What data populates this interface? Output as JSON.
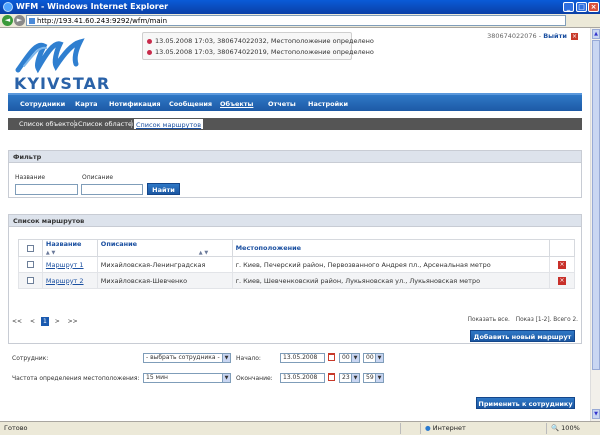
{
  "window": {
    "title": "WFM - Windows Internet Explorer"
  },
  "address": {
    "url": "http://193.41.60.243:9292/wfm/main"
  },
  "brand": {
    "logo_text": "KYIVSTAR"
  },
  "notifications": [
    "13.05.2008 17:03, 380674022032, Местоположение определено",
    "13.05.2008 17:03, 380674022019, Местоположение определено"
  ],
  "user": {
    "phone": "380674022076",
    "logout": "Выйти"
  },
  "nav": {
    "items": [
      "Сотрудники",
      "Карта",
      "Нотификация",
      "Сообщения",
      "Объекты",
      "Отчеты",
      "Настройки"
    ],
    "active": "Объекты"
  },
  "subnav": {
    "items": [
      "Список объектов",
      "Список областей",
      "Список маршрутов"
    ],
    "active": "Список маршрутов"
  },
  "filter": {
    "title": "Фильтр",
    "name_label": "Название",
    "desc_label": "Описание",
    "name_value": "",
    "desc_value": "",
    "find": "Найти"
  },
  "routes": {
    "title": "Список маршрутов",
    "columns": [
      "Название",
      "Описание",
      "Местоположение"
    ],
    "rows": [
      {
        "name": "Маршрут 1",
        "desc": "Михайловская-Ленинградская",
        "loc": "г. Киев, Печерский район, Первозванного Андрея пл., Арсенальная метро"
      },
      {
        "name": "Маршрут 2",
        "desc": "Михайловская-Шевченко",
        "loc": "г. Киев, Шевченковский район, Лукьяновская ул., Лукьяновская метро"
      }
    ],
    "pager": {
      "first": "<<",
      "prev": "<",
      "current": "1",
      "next": ">",
      "last": ">>",
      "show_all": "Показать все.",
      "range": "Показ [1-2]. Всего 2."
    },
    "add_button": "Добавить новый маршрут"
  },
  "assign": {
    "employee_label": "Сотрудник:",
    "employee_value": "- выбрать сотрудника -",
    "freq_label": "Частота определения местоположения:",
    "freq_value": "15 мин",
    "start_label": "Начало:",
    "start_date": "13.05.2008",
    "start_hour": "00",
    "start_min": "00",
    "end_label": "Окончание:",
    "end_date": "13.05.2008",
    "end_hour": "23",
    "end_min": "59",
    "apply_button": "Применить к сотруднику"
  },
  "statusbar": {
    "text": "Готово",
    "zone": "Интернет",
    "zoom": "100%"
  }
}
